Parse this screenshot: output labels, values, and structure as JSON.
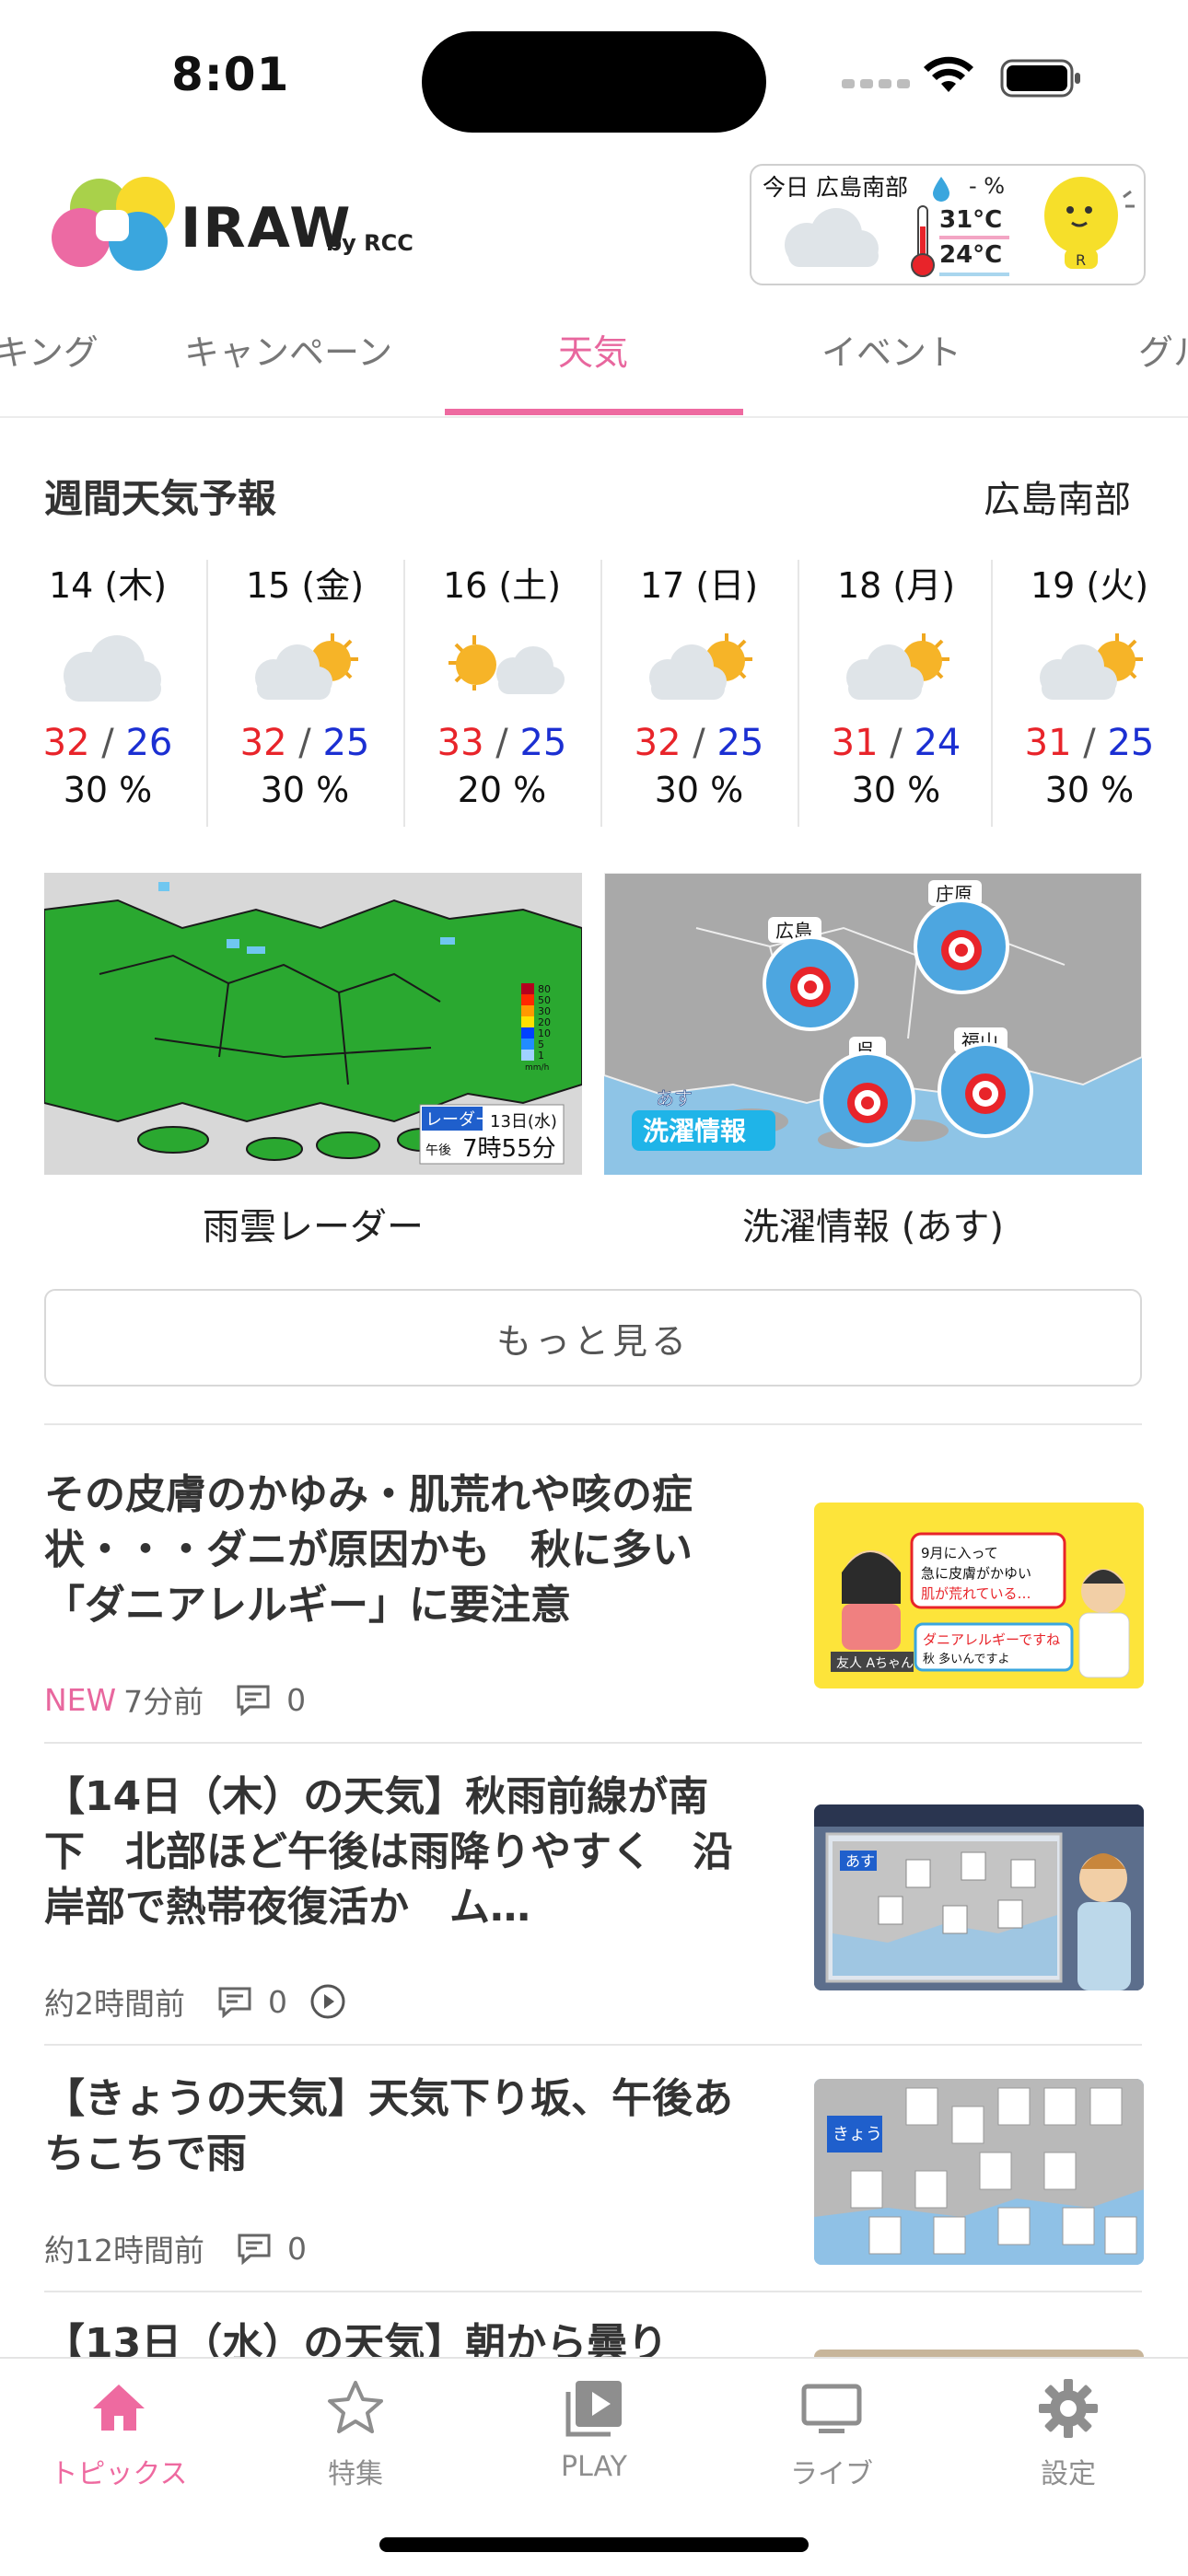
{
  "status_bar": {
    "time": "8:01"
  },
  "header": {
    "logo_text": "IRAW",
    "logo_sub": "by RCC",
    "widget": {
      "label": "今日 広島南部",
      "precip": "- %",
      "high": "31°C",
      "low": "24°C"
    }
  },
  "tabs": [
    {
      "label": "キング"
    },
    {
      "label": "キャンペーン"
    },
    {
      "label": "天気",
      "active": true
    },
    {
      "label": "イベント"
    },
    {
      "label": "グル"
    }
  ],
  "weekly": {
    "title": "週間天気予報",
    "region": "広島南部",
    "days": [
      {
        "label": "14 (木)",
        "icon": "cloudy",
        "high": "32",
        "low": "26",
        "pop": "30 %"
      },
      {
        "label": "15 (金)",
        "icon": "cloudy-then-sunny",
        "high": "32",
        "low": "25",
        "pop": "30 %"
      },
      {
        "label": "16 (土)",
        "icon": "sunny-then-cloudy",
        "high": "33",
        "low": "25",
        "pop": "20 %"
      },
      {
        "label": "17 (日)",
        "icon": "cloudy-then-sunny",
        "high": "32",
        "low": "25",
        "pop": "30 %"
      },
      {
        "label": "18 (月)",
        "icon": "cloudy-then-sunny",
        "high": "31",
        "low": "24",
        "pop": "30 %"
      },
      {
        "label": "19 (火)",
        "icon": "cloudy-then-sunny",
        "high": "31",
        "low": "25",
        "pop": "30 %"
      }
    ]
  },
  "maps": {
    "radar": {
      "caption": "雨雲レーダー",
      "legend": [
        "80",
        "50",
        "30",
        "20",
        "10",
        "5",
        "1"
      ],
      "legend_unit": "mm/h",
      "radar_label": "レーダー",
      "date": "13日(水)",
      "time_prefix": "午後",
      "time": "7時55分"
    },
    "laundry": {
      "caption": "洗濯情報 (あす)",
      "badge_top": "あす",
      "badge": "洗濯情報",
      "cities": [
        "広島",
        "庄原",
        "呉",
        "福山"
      ]
    }
  },
  "more_button": "もっと見る",
  "articles": [
    {
      "title": "その皮膚のかゆみ・肌荒れや咳の症状・・・ダニが原因かも　秋に多い「ダニアレルギー」に要注意",
      "new": "NEW",
      "time": "7分前",
      "comments": "0",
      "has_video": false,
      "thumb": {
        "bubble": "9月に入って急に皮膚がかゆい肌が荒れている…",
        "name": "友人 Aちゃん",
        "reply": "ダニアレルギーですね 秋 多いんですよ"
      }
    },
    {
      "title": "【14日（木）の天気】秋雨前線が南下　北部ほど午後は雨降りやすく　沿岸部で熱帯夜復活か　ム…",
      "new": "",
      "time": "約2時間前",
      "comments": "0",
      "has_video": true,
      "thumb": {
        "label": "あす"
      }
    },
    {
      "title": "【きょうの天気】天気下り坂、午後あちこちで雨",
      "new": "",
      "time": "約12時間前",
      "comments": "0",
      "has_video": false,
      "thumb": {
        "label": "きょう"
      }
    },
    {
      "title": "【13日（水）の天気】朝から曇り",
      "new": "",
      "time": "",
      "comments": "",
      "has_video": false,
      "thumb": {}
    }
  ],
  "bottom_nav": [
    {
      "label": "トピックス",
      "icon": "home-icon",
      "active": true
    },
    {
      "label": "特集",
      "icon": "star-icon"
    },
    {
      "label": "PLAY",
      "icon": "play-library-icon"
    },
    {
      "label": "ライブ",
      "icon": "tv-icon"
    },
    {
      "label": "設定",
      "icon": "gear-icon"
    }
  ],
  "colors": {
    "accent": "#ee6aa0",
    "high_temp": "#e8242a",
    "low_temp": "#1b2fd2"
  }
}
